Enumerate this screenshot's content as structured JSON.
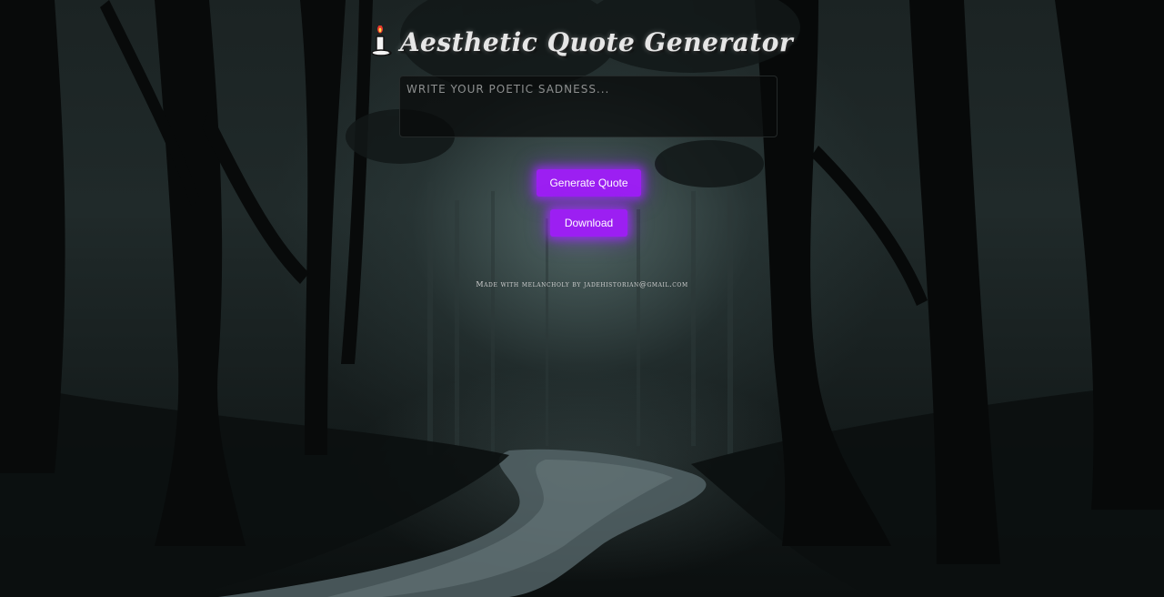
{
  "header": {
    "title": "Aesthetic Quote Generator",
    "icon": "candle-icon"
  },
  "input": {
    "placeholder": "Write your poetic sadness...",
    "value": ""
  },
  "actions": {
    "generate_label": "Generate Quote",
    "download_label": "Download"
  },
  "footer": {
    "credit": "Made with melancholy by jadehistorian@gmail.com"
  },
  "colors": {
    "button_bg": "#9c1ff2",
    "button_glow": "#a028ff",
    "title_text": "#e6e6e6"
  }
}
